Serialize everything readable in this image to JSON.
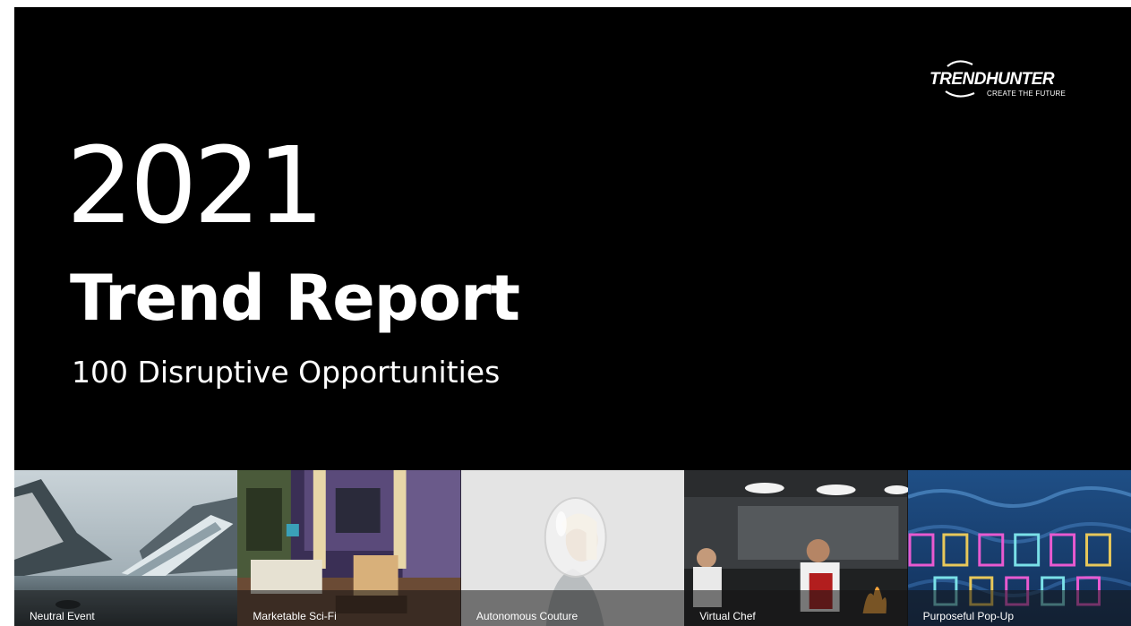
{
  "brand": {
    "name": "TRENDHUNTER",
    "tagline": "CREATE THE FUTURE"
  },
  "hero": {
    "year": "2021",
    "title": "Trend Report",
    "subtitle": "100 Disruptive Opportunities"
  },
  "trends": [
    {
      "label": "Neutral Event",
      "scene": "mountain-lake-pavilion"
    },
    {
      "label": "Marketable Sci-Fi",
      "scene": "sitcom-living-room-set"
    },
    {
      "label": "Autonomous Couture",
      "scene": "bubble-helmet-portrait"
    },
    {
      "label": "Virtual Chef",
      "scene": "restaurant-kitchen"
    },
    {
      "label": "Purposeful Pop-Up",
      "scene": "museum-of-plastic-neon"
    }
  ],
  "colors": {
    "background": "#000000",
    "text": "#ffffff",
    "caption_overlay": "#141414"
  }
}
